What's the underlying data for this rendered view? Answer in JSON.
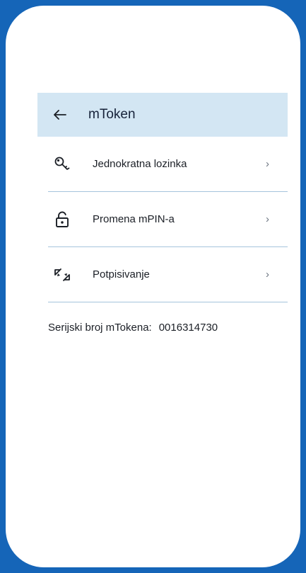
{
  "header": {
    "title": "mToken",
    "back_icon": "arrow-left-icon"
  },
  "menu": {
    "items": [
      {
        "label": "Jednokratna lozinka",
        "icon": "key-icon",
        "chevron": "›"
      },
      {
        "label": "Promena mPIN-a",
        "icon": "unlock-icon",
        "chevron": "›"
      },
      {
        "label": "Potpisivanje",
        "icon": "sign-icon",
        "chevron": "›"
      }
    ]
  },
  "serial": {
    "label": "Serijski broj mTokena:",
    "value": "0016314730"
  },
  "colors": {
    "frame": "#1565b8",
    "header_bg": "#d3e6f3",
    "divider": "#a5c4dc"
  }
}
